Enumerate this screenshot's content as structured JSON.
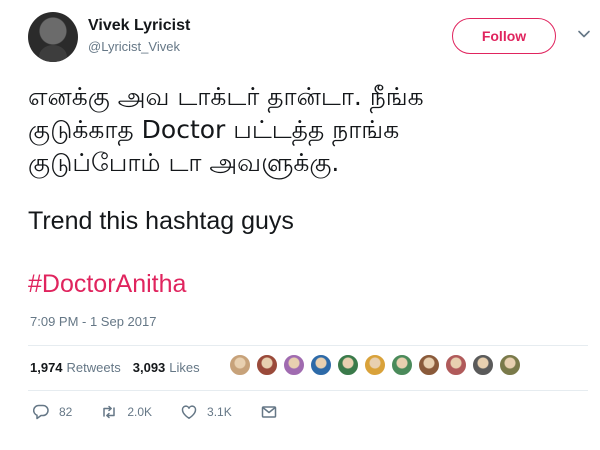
{
  "author": {
    "name": "Vivek Lyricist",
    "handle": "@Lyricist_Vivek"
  },
  "follow_label": "Follow",
  "tweet": {
    "tamil_lines": [
      "எனக்கு அவ டாக்டர் தான்டா. நீங்க",
      "குடுக்காத Doctor பட்டத்த நாங்க",
      "குடுப்போம் டா அவளுக்கு."
    ],
    "english": "Trend this hashtag guys",
    "hashtag": "#DoctorAnitha"
  },
  "timestamp": "7:09 PM - 1 Sep 2017",
  "stats": {
    "retweets_count": "1,974",
    "retweets_label": "Retweets",
    "likes_count": "3,093",
    "likes_label": "Likes"
  },
  "liker_avatar_colors": [
    "#c7a27a",
    "#9a4a3a",
    "#a06bb0",
    "#2d6aa8",
    "#3a7a4a",
    "#d9a23a",
    "#4a8a5a",
    "#8a5a3a",
    "#b05a5a",
    "#5a5a5a",
    "#7a7a4a"
  ],
  "actions": {
    "replies": "82",
    "retweets": "2.0K",
    "likes": "3.1K"
  },
  "colors": {
    "accent": "#e0245e",
    "muted": "#657786",
    "text": "#14171a"
  },
  "icons": [
    "reply-icon",
    "retweet-icon",
    "heart-icon",
    "message-icon",
    "chevron-down-icon"
  ]
}
